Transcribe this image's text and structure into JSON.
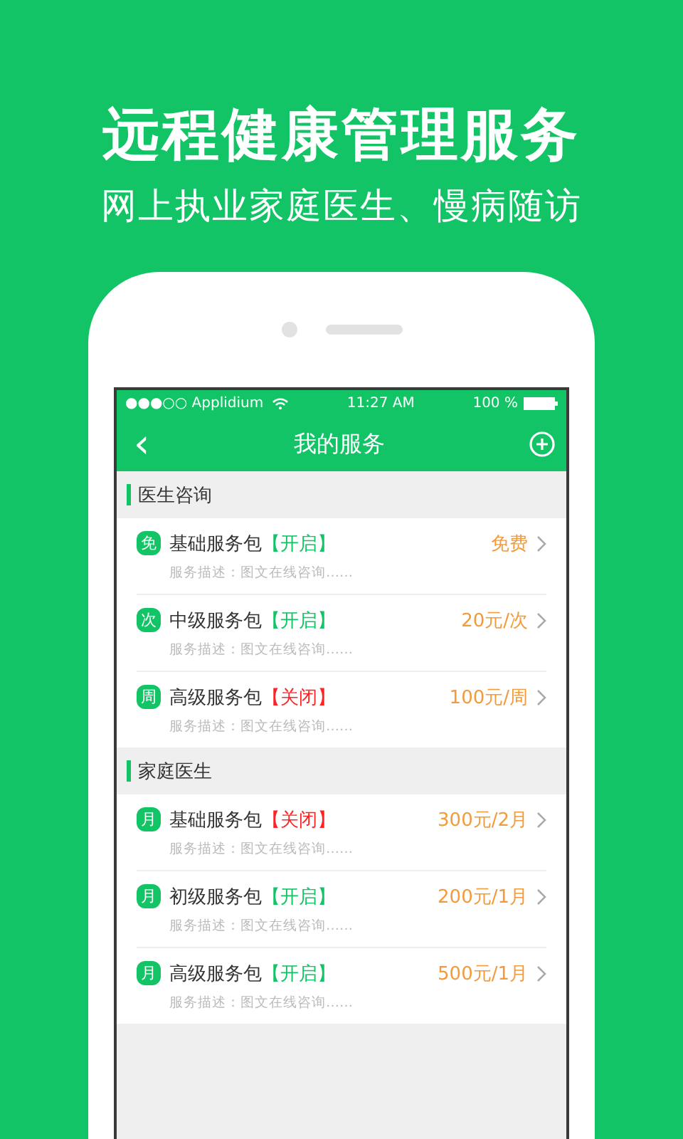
{
  "headline": "远程健康管理服务",
  "subtitle": "网上执业家庭医生、慢病随访",
  "status_bar": {
    "carrier": "●●●○○ Applidium",
    "time": "11:27 AM",
    "battery": "100 %"
  },
  "nav": {
    "back": "‹",
    "title": "我的服务"
  },
  "sections": [
    {
      "title": "医生咨询",
      "items": [
        {
          "badge": "免",
          "name": "基础服务包",
          "status": "【开启】",
          "enabled": true,
          "price": "免费",
          "description": "服务描述：图文在线咨询……"
        },
        {
          "badge": "次",
          "name": "中级服务包",
          "status": "【开启】",
          "enabled": true,
          "price": "20元/次",
          "description": "服务描述：图文在线咨询……"
        },
        {
          "badge": "周",
          "name": "高级服务包",
          "status": "【关闭】",
          "enabled": false,
          "price": "100元/周",
          "description": "服务描述：图文在线咨询……"
        }
      ]
    },
    {
      "title": "家庭医生",
      "items": [
        {
          "badge": "月",
          "name": "基础服务包",
          "status": "【关闭】",
          "enabled": false,
          "price": "300元/2月",
          "description": "服务描述：图文在线咨询……"
        },
        {
          "badge": "月",
          "name": "初级服务包",
          "status": "【开启】",
          "enabled": true,
          "price": "200元/1月",
          "description": "服务描述：图文在线咨询……"
        },
        {
          "badge": "月",
          "name": "高级服务包",
          "status": "【开启】",
          "enabled": true,
          "price": "500元/1月",
          "description": "服务描述：图文在线咨询……"
        }
      ]
    }
  ]
}
